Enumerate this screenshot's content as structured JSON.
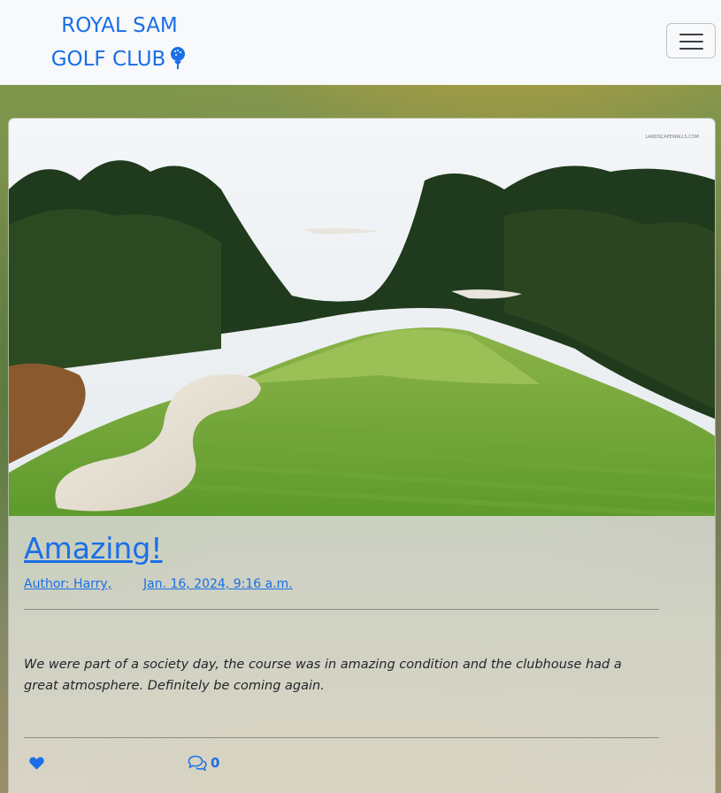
{
  "brand": {
    "line1": "ROYAL SAM",
    "line2": "GOLF CLUB"
  },
  "colors": {
    "brand": "#1a6fe6",
    "navbar_bg": "#f8f9fa"
  },
  "icons": {
    "brand_icon": "golf-ball-tee-icon",
    "menu": "hamburger-icon",
    "like": "heart-icon",
    "comments": "comments-icon"
  },
  "post": {
    "title": "Amazing!",
    "author": "Author: Harry, ",
    "date": "Jan. 16, 2024, 9:16 a.m.",
    "body": "We were part of a society day, the course was in amazing condition and the clubhouse had a great atmosphere. Definitely be coming again.",
    "comment_count": "0",
    "image_watermark": "LANDSCAPEWALLS.COM"
  }
}
